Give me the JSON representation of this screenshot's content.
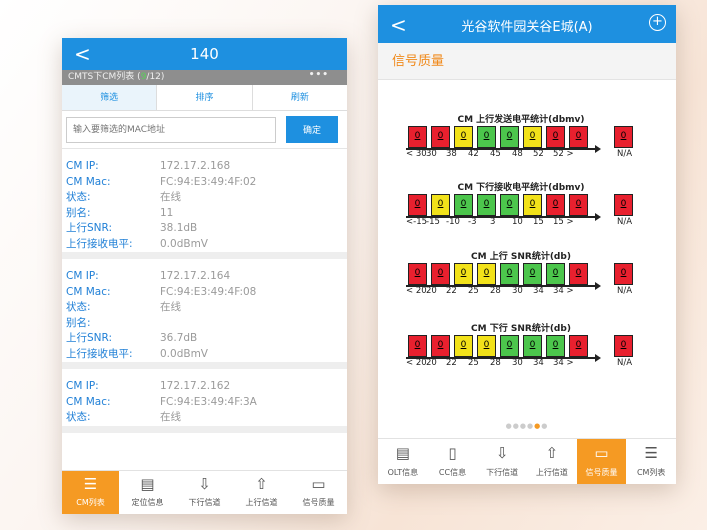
{
  "left": {
    "title": "140",
    "back": "<",
    "subtitle_prefix": "CMTS下CM列表 (",
    "subtitle_count": "9",
    "subtitle_suffix": "/12)",
    "more": "•••",
    "tabs": [
      "筛选",
      "排序",
      "刷新"
    ],
    "filter_placeholder": "输入要筛选的MAC地址",
    "confirm": "确定",
    "labels": {
      "ip": "CM IP:",
      "mac": "CM Mac:",
      "status": "状态:",
      "alias": "别名:",
      "snr": "上行SNR:",
      "rx": "上行接收电平:"
    },
    "cards": [
      {
        "ip": "172.17.2.168",
        "mac": "FC:94:E3:49:4F:02",
        "status": "在线",
        "alias": "11",
        "snr": "38.1dB",
        "rx": "0.0dBmV"
      },
      {
        "ip": "172.17.2.164",
        "mac": "FC:94:E3:49:4F:08",
        "status": "在线",
        "alias": "",
        "snr": "36.7dB",
        "rx": "0.0dBmV"
      },
      {
        "ip": "172.17.2.162",
        "mac": "FC:94:E3:49:4F:3A",
        "status": "在线",
        "alias": "",
        "snr": "",
        "rx": ""
      }
    ],
    "nav": [
      "CM列表",
      "定位信息",
      "下行信道",
      "上行信道",
      "信号质量"
    ]
  },
  "right": {
    "title": "光谷软件园关谷E城(A)",
    "back": "<",
    "plus": "+",
    "section": "信号质量",
    "charts": [
      {
        "title": "CM 上行发送电平统计(dbmv)",
        "cells": [
          [
            "r",
            "0"
          ],
          [
            "r",
            "0"
          ],
          [
            "y",
            "0"
          ],
          [
            "g",
            "0"
          ],
          [
            "g",
            "0"
          ],
          [
            "y",
            "0"
          ],
          [
            "r",
            "0"
          ],
          [
            "r",
            "0"
          ]
        ],
        "ticks": [
          "< 30",
          "30",
          "38",
          "42",
          "45",
          "48",
          "52",
          "52 >",
          "N/A"
        ]
      },
      {
        "title": "CM 下行接收电平统计(dbmv)",
        "cells": [
          [
            "r",
            "0"
          ],
          [
            "y",
            "0"
          ],
          [
            "g",
            "0"
          ],
          [
            "g",
            "0"
          ],
          [
            "g",
            "0"
          ],
          [
            "y",
            "0"
          ],
          [
            "r",
            "0"
          ],
          [
            "r",
            "0"
          ]
        ],
        "ticks": [
          "<-15",
          "-15",
          "-10",
          "-3",
          "3",
          "10",
          "15",
          "15 >",
          "N/A"
        ]
      },
      {
        "title": "CM 上行 SNR统计(db)",
        "cells": [
          [
            "r",
            "0"
          ],
          [
            "r",
            "0"
          ],
          [
            "y",
            "0"
          ],
          [
            "y",
            "0"
          ],
          [
            "g",
            "0"
          ],
          [
            "g",
            "0"
          ],
          [
            "g",
            "0"
          ],
          [
            "r",
            "0"
          ]
        ],
        "ticks": [
          "< 20",
          "20",
          "22",
          "25",
          "28",
          "30",
          "34",
          "34 >",
          "N/A"
        ]
      },
      {
        "title": "CM 下行 SNR统计(db)",
        "cells": [
          [
            "r",
            "0"
          ],
          [
            "r",
            "0"
          ],
          [
            "y",
            "0"
          ],
          [
            "y",
            "0"
          ],
          [
            "g",
            "0"
          ],
          [
            "g",
            "0"
          ],
          [
            "g",
            "0"
          ],
          [
            "r",
            "0"
          ]
        ],
        "ticks": [
          "< 20",
          "20",
          "22",
          "25",
          "28",
          "30",
          "34",
          "34 >",
          "N/A"
        ]
      }
    ],
    "nav": [
      "OLT信息",
      "CC信息",
      "下行信道",
      "上行信道",
      "信号质量",
      "CM列表"
    ]
  },
  "colors": {
    "r": "#e8202e",
    "y": "#f2e21a",
    "g": "#4cc64c",
    "blue": "#1e90e0",
    "orange": "#f59a23"
  }
}
